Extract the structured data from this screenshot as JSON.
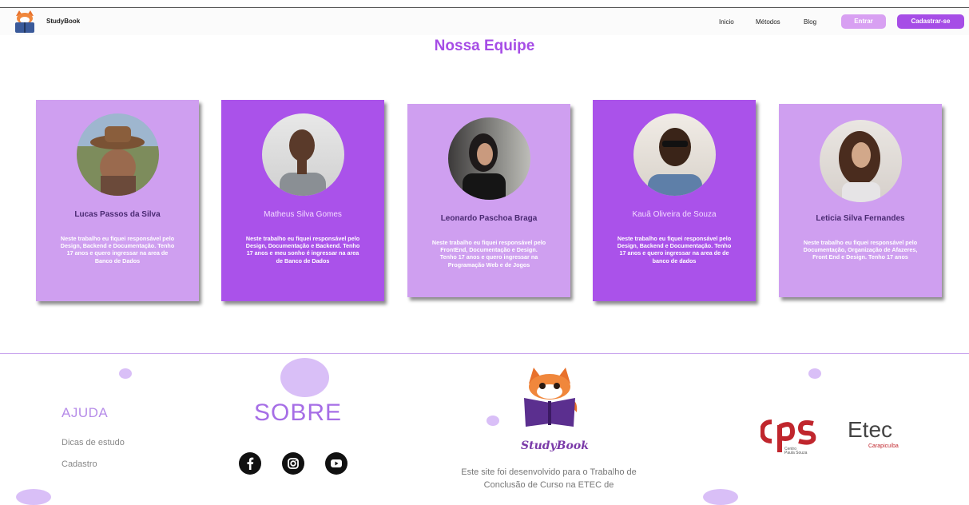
{
  "nav": {
    "brand": "StudyBook",
    "links": [
      "Inicio",
      "Métodos",
      "Blog"
    ],
    "login": "Entrar",
    "signup": "Cadastrar-se"
  },
  "section_title": "Nossa Equipe",
  "members": [
    {
      "name": "Lucas Passos da Silva",
      "desc": "Neste trabalho eu fiquei responsável pelo Design, Backend e Documentação. Tenho 17 anos e quero ingressar na area de Banco de Dados"
    },
    {
      "name": "Matheus Silva Gomes",
      "desc": "Neste trabalho eu fiquei responsável pelo Design, Documentação e Backend. Tenho 17 anos e meu sonho é ingressar na area de Banco de Dados"
    },
    {
      "name": "Leonardo Paschoa Braga",
      "desc": "Neste trabalho eu fiquei responsável pelo FrontEnd, Documentação e Design. Tenho 17 anos e quero ingressar na Programação Web e de Jogos"
    },
    {
      "name": "Kauã Oliveira de Souza",
      "desc": "Neste trabalho eu fiquei responsável pelo Design, Backend e Documentação. Tenho 17 anos e quero ingressar na area de de banco de dados"
    },
    {
      "name": "Leticia Silva Fernandes",
      "desc": "Neste trabalho eu fiquei responsável pelo Documentação, Organização de Afazeres, Front End e Design. Tenho 17 anos"
    }
  ],
  "footer": {
    "help_title": "AJUDA",
    "help_links": [
      "Dicas de estudo",
      "Cadastro"
    ],
    "about_title": "SOBRE",
    "brand": "StudyBook",
    "about_text": "Este site foi desenvolvido para o Trabalho de Conclusão de Curso na ETEC de",
    "cps_text": "Centro Paula Souza",
    "etec_title": "Etec",
    "etec_sub": "Carapicuíba"
  },
  "colors": {
    "accent": "#a64de6",
    "card_light": "#cf9ff0",
    "card_dark": "#aa52ea"
  },
  "icons": [
    "facebook-icon",
    "instagram-icon",
    "youtube-icon"
  ]
}
